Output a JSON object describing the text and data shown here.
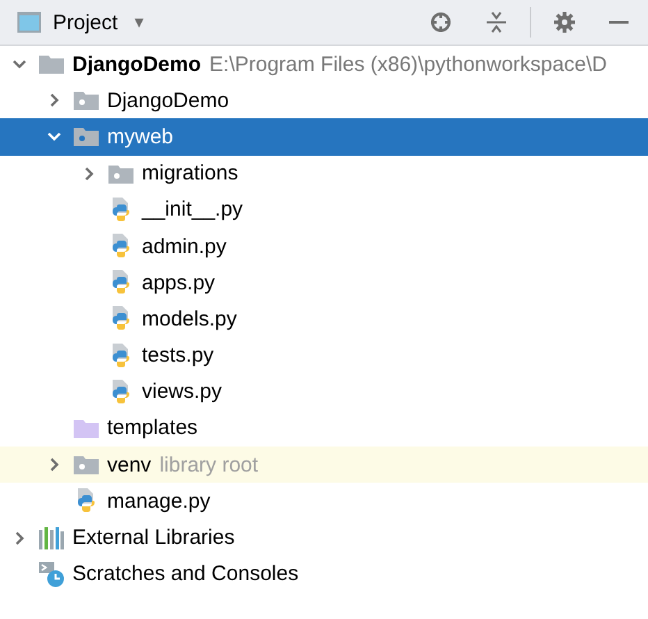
{
  "header": {
    "title": "Project",
    "dropdown_caret": "▾"
  },
  "tree": [
    {
      "kind": "project",
      "label": "DjangoDemo",
      "hint": "E:\\Program Files (x86)\\pythonworkspace\\D",
      "expanded": true,
      "selected": false,
      "highlighted": false,
      "children": [
        {
          "kind": "package",
          "label": "DjangoDemo",
          "expanded": false,
          "selected": false,
          "highlighted": false
        },
        {
          "kind": "package",
          "label": "myweb",
          "expanded": true,
          "selected": true,
          "highlighted": false,
          "children": [
            {
              "kind": "package",
              "label": "migrations",
              "expanded": false,
              "selected": false,
              "highlighted": false
            },
            {
              "kind": "python-file",
              "label": "__init__.py",
              "selected": false,
              "highlighted": false
            },
            {
              "kind": "python-file",
              "label": "admin.py",
              "selected": false,
              "highlighted": false
            },
            {
              "kind": "python-file",
              "label": "apps.py",
              "selected": false,
              "highlighted": false
            },
            {
              "kind": "python-file",
              "label": "models.py",
              "selected": false,
              "highlighted": false
            },
            {
              "kind": "python-file",
              "label": "tests.py",
              "selected": false,
              "highlighted": false
            },
            {
              "kind": "python-file",
              "label": "views.py",
              "selected": false,
              "highlighted": false
            }
          ]
        },
        {
          "kind": "templates",
          "label": "templates",
          "selected": false,
          "highlighted": false
        },
        {
          "kind": "package",
          "label": "venv",
          "hint": "library root",
          "expanded": false,
          "selected": false,
          "highlighted": true
        },
        {
          "kind": "python-file",
          "label": "manage.py",
          "selected": false,
          "highlighted": false
        }
      ]
    },
    {
      "kind": "libraries",
      "label": "External Libraries",
      "expanded": false,
      "selected": false,
      "highlighted": false
    },
    {
      "kind": "scratches",
      "label": "Scratches and Consoles",
      "selected": false,
      "highlighted": false
    }
  ]
}
